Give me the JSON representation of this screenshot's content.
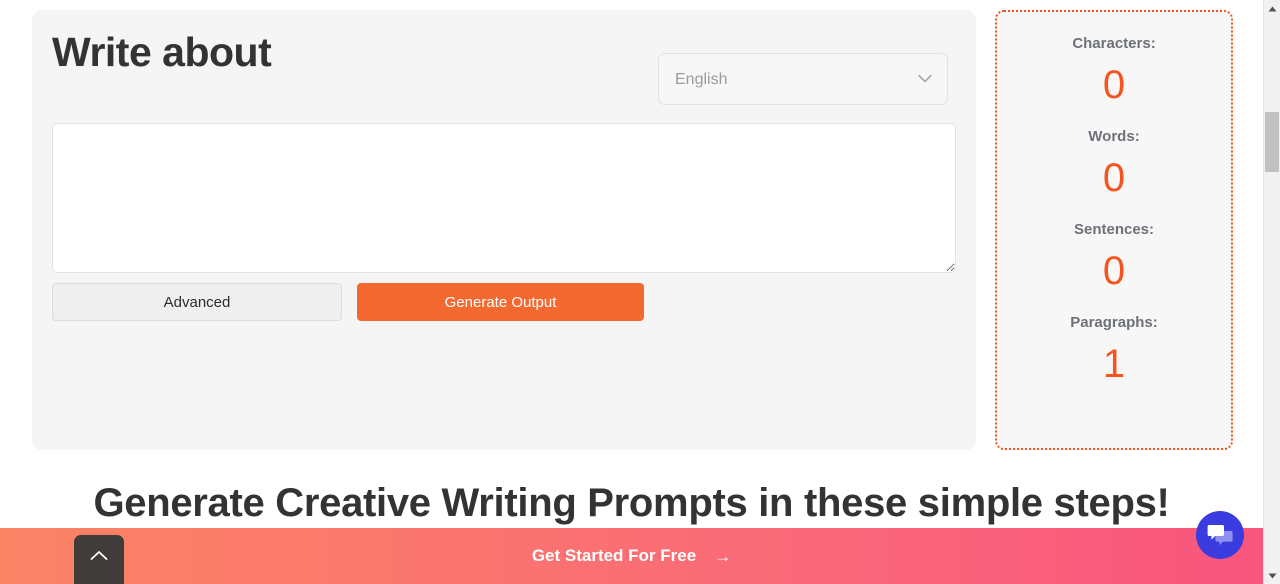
{
  "generator": {
    "title": "Write about",
    "language_select": {
      "selected": "English",
      "options": [
        "English"
      ],
      "chevron_icon": "chevron-down-icon"
    },
    "textarea": {
      "value": "",
      "placeholder": ""
    },
    "buttons": {
      "advanced": "Advanced",
      "generate": "Generate Output"
    }
  },
  "stats": {
    "items": [
      {
        "label": "Characters:",
        "value": "0"
      },
      {
        "label": "Words:",
        "value": "0"
      },
      {
        "label": "Sentences:",
        "value": "0"
      },
      {
        "label": "Paragraphs:",
        "value": "1"
      }
    ]
  },
  "section": {
    "headline": "Generate Creative Writing Prompts in these simple steps!"
  },
  "cta": {
    "label": "Get Started For Free",
    "arrow": "→"
  },
  "scroll_top": {
    "icon": "chevron-up-icon"
  },
  "chat": {
    "icon": "chat-bubble-icon"
  },
  "scrollbar": {
    "up_arrow": "▲",
    "down_arrow": "▼"
  },
  "colors": {
    "accent_orange": "#f4692f",
    "stat_orange": "#f4551f",
    "cta_gradient_start": "#fa8365",
    "cta_gradient_end": "#f9557e",
    "card_bg": "#f5f5f6",
    "chat_blue": "#3b3ce0",
    "scroll_top_dark": "#403c3a"
  }
}
